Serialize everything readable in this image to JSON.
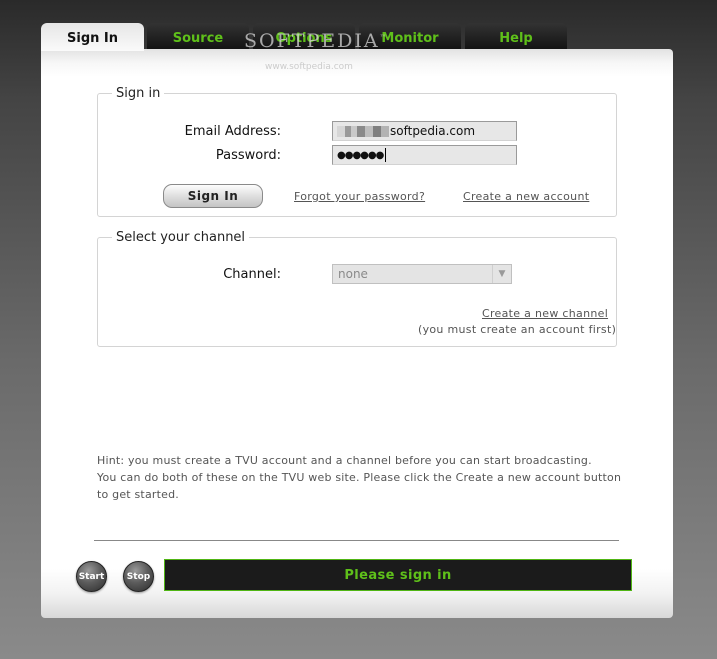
{
  "tabs": [
    {
      "label": "Sign In",
      "active": true
    },
    {
      "label": "Source",
      "active": false
    },
    {
      "label": "Options",
      "active": false
    },
    {
      "label": "Monitor",
      "active": false
    },
    {
      "label": "Help",
      "active": false
    }
  ],
  "watermark": {
    "text": "SOFTPEDIA",
    "tm": "™",
    "url": "www.softpedia.com"
  },
  "signin": {
    "legend": "Sign in",
    "email_label": "Email Address:",
    "email_value": "softpedia.com",
    "password_label": "Password:",
    "password_value": "●●●●●●",
    "signin_button": "Sign In",
    "forgot_link": "Forgot your password?",
    "create_account_link": "Create a new account"
  },
  "channel": {
    "legend": "Select your channel",
    "channel_label": "Channel:",
    "selected": "none",
    "create_channel_link": "Create a new channel",
    "note": "(you must create an account first)"
  },
  "hint": {
    "line1": "Hint: you must create a TVU account and a channel before you can start broadcasting.",
    "line2": "You can do both of these on the TVU web site. Please click the Create a new account button",
    "line3": "to get started."
  },
  "controls": {
    "start": "Start",
    "stop": "Stop",
    "status": "Please sign in"
  },
  "colors": {
    "accent_green": "#5fc01a",
    "tab_bg": "#111111",
    "status_bg": "#1b1b1b"
  },
  "icons": {
    "dropdown": "chevron-down-icon"
  }
}
